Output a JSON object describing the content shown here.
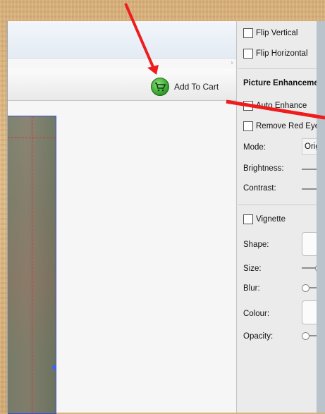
{
  "toolbar": {
    "add_to_cart_label": "Add To Cart"
  },
  "panel": {
    "flip_vertical": "Flip Vertical",
    "flip_horizontal": "Flip Horizontal",
    "enhancement_title": "Picture Enhancement",
    "auto_enhance": "Auto Enhance",
    "remove_red_eye": "Remove Red Eye",
    "mode_label": "Mode:",
    "mode_value": "Original",
    "brightness_label": "Brightness:",
    "contrast_label": "Contrast:",
    "vignette": "Vignette",
    "shape_label": "Shape:",
    "size_label": "Size:",
    "blur_label": "Blur:",
    "colour_label": "Colour:",
    "opacity_label": "Opacity:"
  },
  "colors": {
    "accent_arrow": "#ee1c1c",
    "cart_green": "#2e9a28",
    "selection_border": "#3d4fd6",
    "guide_line": "#e03030"
  },
  "icons": {
    "cart": "shopping-cart-icon",
    "chevron": "chevron-right-icon"
  }
}
